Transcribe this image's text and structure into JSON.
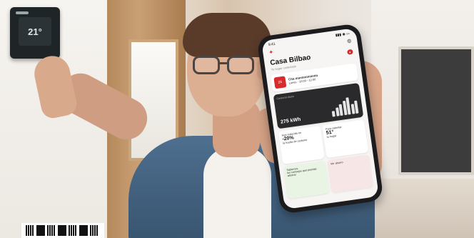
{
  "thermostat": {
    "display": "21°"
  },
  "phone": {
    "status_time": "9:41",
    "status_icons": "▮▮▮ ◉ ▭",
    "home_title": "Casa Bilbao",
    "home_badge": "●",
    "home_subtitle": "Tu hogar conectado",
    "appointment": {
      "day": "26",
      "title": "Cita mantenimiento",
      "detail": "Lunes · 10:00 - 12:00"
    },
    "energy": {
      "label": "Consumo diario",
      "value": "275 kWh"
    },
    "tiles": [
      {
        "title": "Has reducido en",
        "highlight": "-20%",
        "text": "la huella de carbono"
      },
      {
        "title": "Para calentar",
        "highlight": "51°",
        "text": "tu hogar"
      },
      {
        "title": "Sabemos",
        "highlight": "",
        "text": "los consejos que puedas ahorrar"
      },
      {
        "title": "Ver ahorro",
        "highlight": "",
        "text": ""
      }
    ]
  },
  "colors": {
    "brand": "#d82c2c",
    "dark_card": "#2a2a2c"
  }
}
